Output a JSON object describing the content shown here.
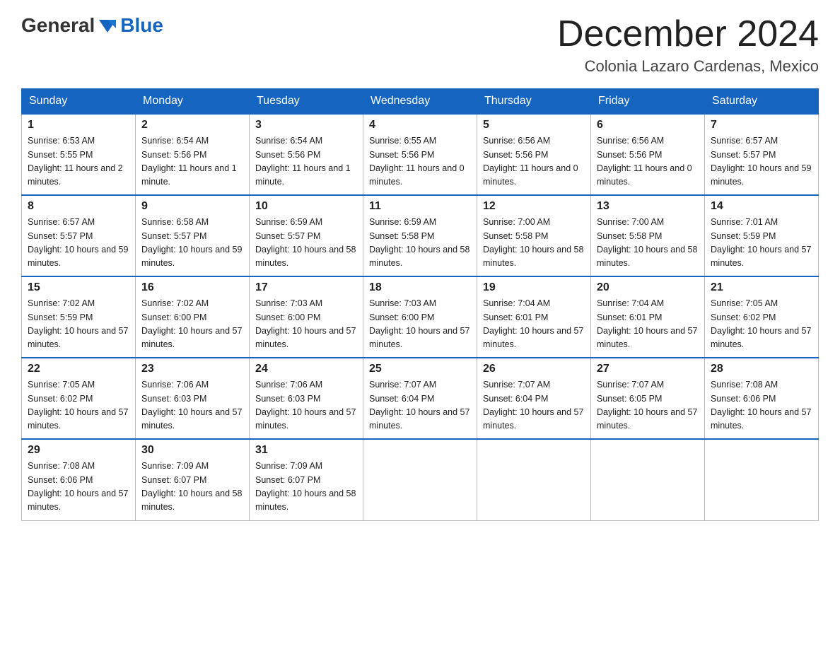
{
  "header": {
    "logo_general": "General",
    "logo_blue": "Blue",
    "month_title": "December 2024",
    "location": "Colonia Lazaro Cardenas, Mexico"
  },
  "days_of_week": [
    "Sunday",
    "Monday",
    "Tuesday",
    "Wednesday",
    "Thursday",
    "Friday",
    "Saturday"
  ],
  "weeks": [
    [
      {
        "day": "1",
        "sunrise": "6:53 AM",
        "sunset": "5:55 PM",
        "daylight": "11 hours and 2 minutes."
      },
      {
        "day": "2",
        "sunrise": "6:54 AM",
        "sunset": "5:56 PM",
        "daylight": "11 hours and 1 minute."
      },
      {
        "day": "3",
        "sunrise": "6:54 AM",
        "sunset": "5:56 PM",
        "daylight": "11 hours and 1 minute."
      },
      {
        "day": "4",
        "sunrise": "6:55 AM",
        "sunset": "5:56 PM",
        "daylight": "11 hours and 0 minutes."
      },
      {
        "day": "5",
        "sunrise": "6:56 AM",
        "sunset": "5:56 PM",
        "daylight": "11 hours and 0 minutes."
      },
      {
        "day": "6",
        "sunrise": "6:56 AM",
        "sunset": "5:56 PM",
        "daylight": "11 hours and 0 minutes."
      },
      {
        "day": "7",
        "sunrise": "6:57 AM",
        "sunset": "5:57 PM",
        "daylight": "10 hours and 59 minutes."
      }
    ],
    [
      {
        "day": "8",
        "sunrise": "6:57 AM",
        "sunset": "5:57 PM",
        "daylight": "10 hours and 59 minutes."
      },
      {
        "day": "9",
        "sunrise": "6:58 AM",
        "sunset": "5:57 PM",
        "daylight": "10 hours and 59 minutes."
      },
      {
        "day": "10",
        "sunrise": "6:59 AM",
        "sunset": "5:57 PM",
        "daylight": "10 hours and 58 minutes."
      },
      {
        "day": "11",
        "sunrise": "6:59 AM",
        "sunset": "5:58 PM",
        "daylight": "10 hours and 58 minutes."
      },
      {
        "day": "12",
        "sunrise": "7:00 AM",
        "sunset": "5:58 PM",
        "daylight": "10 hours and 58 minutes."
      },
      {
        "day": "13",
        "sunrise": "7:00 AM",
        "sunset": "5:58 PM",
        "daylight": "10 hours and 58 minutes."
      },
      {
        "day": "14",
        "sunrise": "7:01 AM",
        "sunset": "5:59 PM",
        "daylight": "10 hours and 57 minutes."
      }
    ],
    [
      {
        "day": "15",
        "sunrise": "7:02 AM",
        "sunset": "5:59 PM",
        "daylight": "10 hours and 57 minutes."
      },
      {
        "day": "16",
        "sunrise": "7:02 AM",
        "sunset": "6:00 PM",
        "daylight": "10 hours and 57 minutes."
      },
      {
        "day": "17",
        "sunrise": "7:03 AM",
        "sunset": "6:00 PM",
        "daylight": "10 hours and 57 minutes."
      },
      {
        "day": "18",
        "sunrise": "7:03 AM",
        "sunset": "6:00 PM",
        "daylight": "10 hours and 57 minutes."
      },
      {
        "day": "19",
        "sunrise": "7:04 AM",
        "sunset": "6:01 PM",
        "daylight": "10 hours and 57 minutes."
      },
      {
        "day": "20",
        "sunrise": "7:04 AM",
        "sunset": "6:01 PM",
        "daylight": "10 hours and 57 minutes."
      },
      {
        "day": "21",
        "sunrise": "7:05 AM",
        "sunset": "6:02 PM",
        "daylight": "10 hours and 57 minutes."
      }
    ],
    [
      {
        "day": "22",
        "sunrise": "7:05 AM",
        "sunset": "6:02 PM",
        "daylight": "10 hours and 57 minutes."
      },
      {
        "day": "23",
        "sunrise": "7:06 AM",
        "sunset": "6:03 PM",
        "daylight": "10 hours and 57 minutes."
      },
      {
        "day": "24",
        "sunrise": "7:06 AM",
        "sunset": "6:03 PM",
        "daylight": "10 hours and 57 minutes."
      },
      {
        "day": "25",
        "sunrise": "7:07 AM",
        "sunset": "6:04 PM",
        "daylight": "10 hours and 57 minutes."
      },
      {
        "day": "26",
        "sunrise": "7:07 AM",
        "sunset": "6:04 PM",
        "daylight": "10 hours and 57 minutes."
      },
      {
        "day": "27",
        "sunrise": "7:07 AM",
        "sunset": "6:05 PM",
        "daylight": "10 hours and 57 minutes."
      },
      {
        "day": "28",
        "sunrise": "7:08 AM",
        "sunset": "6:06 PM",
        "daylight": "10 hours and 57 minutes."
      }
    ],
    [
      {
        "day": "29",
        "sunrise": "7:08 AM",
        "sunset": "6:06 PM",
        "daylight": "10 hours and 57 minutes."
      },
      {
        "day": "30",
        "sunrise": "7:09 AM",
        "sunset": "6:07 PM",
        "daylight": "10 hours and 58 minutes."
      },
      {
        "day": "31",
        "sunrise": "7:09 AM",
        "sunset": "6:07 PM",
        "daylight": "10 hours and 58 minutes."
      },
      null,
      null,
      null,
      null
    ]
  ]
}
